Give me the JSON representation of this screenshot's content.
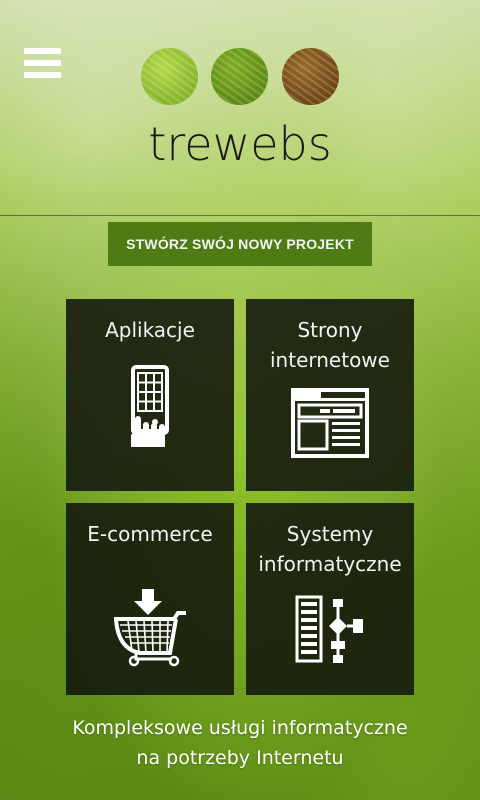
{
  "header": {
    "logo_text": "trewebs",
    "logo_dot_colors": [
      "#9bc83a",
      "#6e9e1a",
      "#855a20"
    ],
    "menu_icon": "hamburger-menu-icon"
  },
  "cta": {
    "label": "STWÓRZ SWÓJ NOWY PROJEKT",
    "color": "#4e7b14"
  },
  "tiles": [
    {
      "title_lines": [
        "Aplikacje"
      ],
      "icon": "mobile-app-icon"
    },
    {
      "title_lines": [
        "Strony",
        "internetowe"
      ],
      "icon": "website-icon"
    },
    {
      "title_lines": [
        "E-commerce"
      ],
      "icon": "shopping-cart-icon"
    },
    {
      "title_lines": [
        "Systemy",
        "informatyczne"
      ],
      "icon": "flowchart-icon"
    }
  ],
  "tagline": {
    "line1": "Kompleksowe usługi informatyczne",
    "line2": "na potrzeby Internetu"
  }
}
